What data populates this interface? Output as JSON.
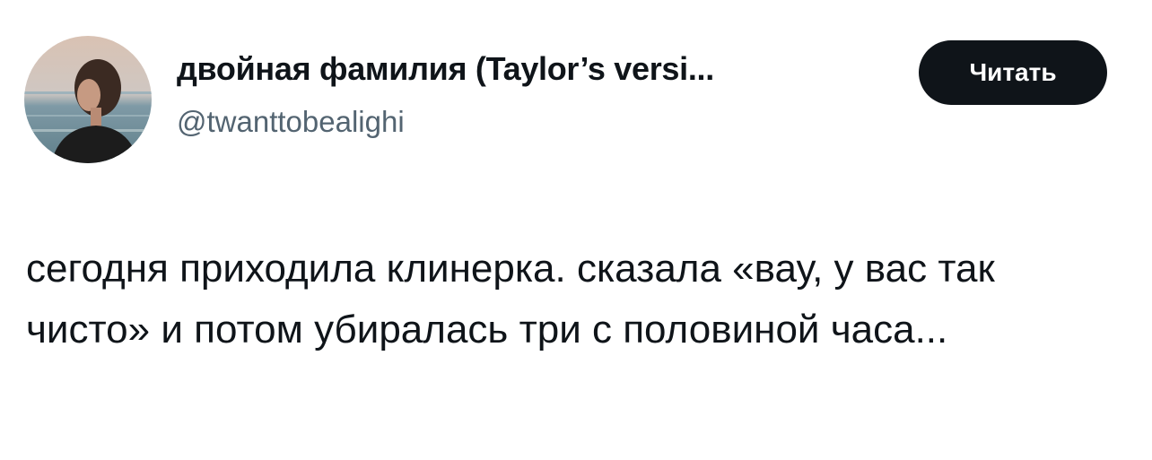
{
  "author": {
    "display_name": "двойная фамилия (Taylor’s versi...",
    "handle": "@twanttobealighi"
  },
  "follow_button_label": "Читать",
  "tweet": {
    "text": "сегодня приходила клинерка. сказала «вау, у вас так чисто» и потом убиралась три с половиной часа..."
  },
  "colors": {
    "text_primary": "#0f1419",
    "text_secondary": "#536471",
    "button_bg": "#0f1419",
    "button_text": "#ffffff",
    "background": "#ffffff"
  },
  "icons": {
    "avatar": "profile-photo"
  }
}
